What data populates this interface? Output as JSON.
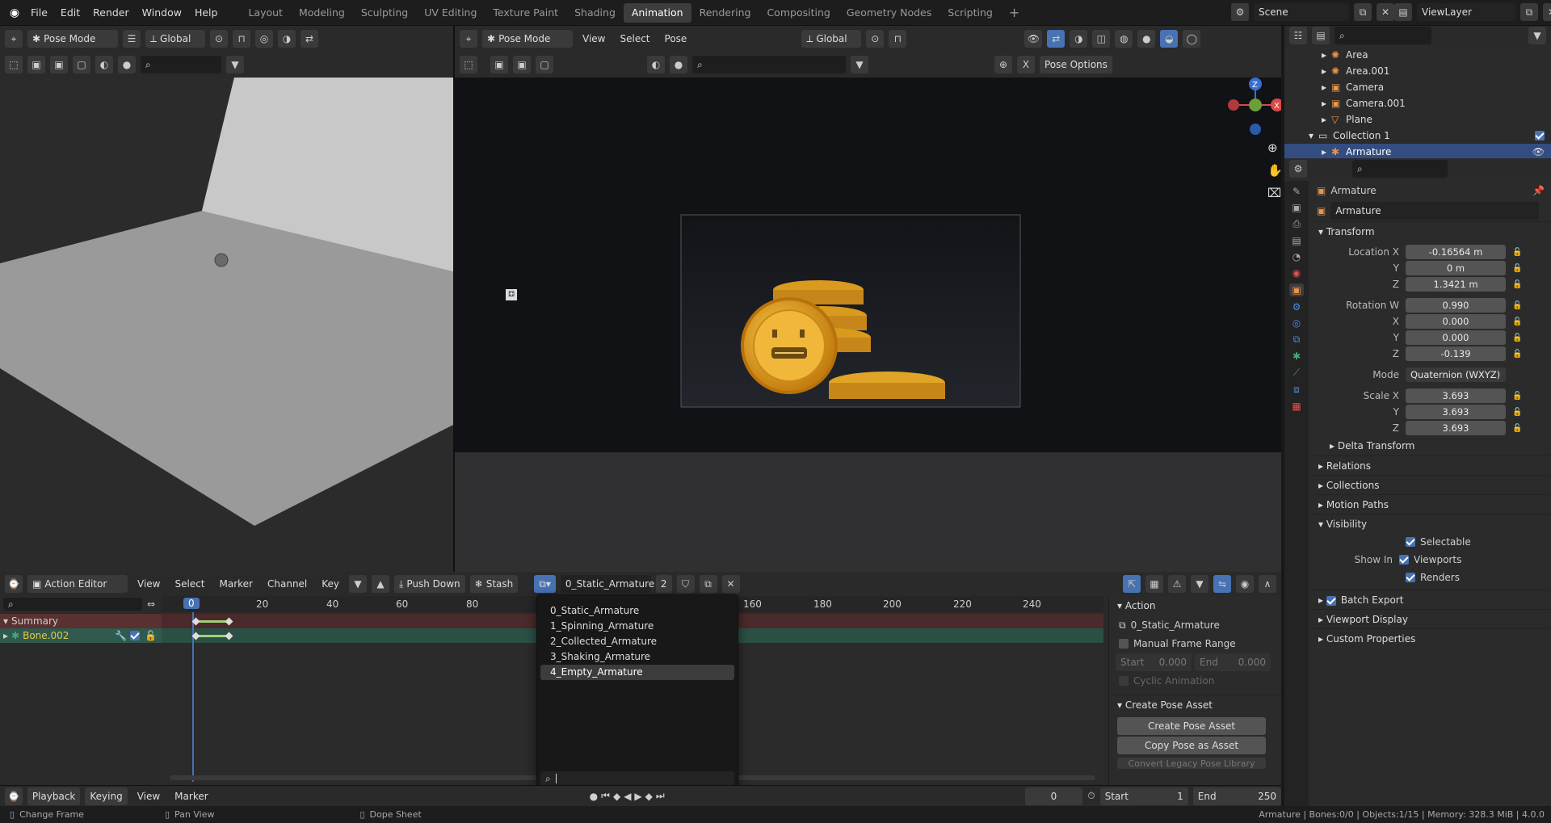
{
  "topbar": {
    "menus": [
      "File",
      "Edit",
      "Render",
      "Window",
      "Help"
    ],
    "workspaces": [
      "Layout",
      "Modeling",
      "Sculpting",
      "UV Editing",
      "Texture Paint",
      "Shading",
      "Animation",
      "Rendering",
      "Compositing",
      "Geometry Nodes",
      "Scripting"
    ],
    "active_workspace": "Animation",
    "scene": "Scene",
    "view_layer": "ViewLayer"
  },
  "left_viewport": {
    "mode": "Pose Mode",
    "orientation": "Global"
  },
  "right_viewport": {
    "mode": "Pose Mode",
    "menus": [
      "View",
      "Select",
      "Pose"
    ],
    "orientation": "Global",
    "pose_options": "Pose Options"
  },
  "outliner": {
    "items": [
      {
        "name": "Area",
        "indent": 1
      },
      {
        "name": "Area.001",
        "indent": 1
      },
      {
        "name": "Camera",
        "indent": 1
      },
      {
        "name": "Camera.001",
        "indent": 1
      },
      {
        "name": "Plane",
        "indent": 1
      },
      {
        "name": "Collection 1",
        "indent": 0
      },
      {
        "name": "Armature",
        "indent": 1,
        "selected": true
      }
    ]
  },
  "properties": {
    "object_name": "Armature",
    "data_name": "Armature",
    "transform_label": "Transform",
    "location": {
      "label": "Location X",
      "x": "-0.16564 m",
      "y": "0 m",
      "z": "1.3421 m"
    },
    "rotation": {
      "label": "Rotation W",
      "w": "0.990",
      "x": "0.000",
      "y": "0.000",
      "z": "-0.139"
    },
    "mode_label": "Mode",
    "mode_value": "Quaternion (WXYZ)",
    "scale": {
      "label": "Scale X",
      "x": "3.693",
      "y": "3.693",
      "z": "3.693"
    },
    "axis": {
      "y": "Y",
      "z": "Z",
      "x": "X"
    },
    "sections": [
      "Delta Transform",
      "Relations",
      "Collections",
      "Motion Paths"
    ],
    "visibility_label": "Visibility",
    "selectable": "Selectable",
    "show_in": "Show In",
    "viewports": "Viewports",
    "renders": "Renders",
    "batch_export": "Batch Export",
    "viewport_display": "Viewport Display",
    "custom_properties": "Custom Properties"
  },
  "dopesheet": {
    "editor": "Action Editor",
    "menus": [
      "View",
      "Select",
      "Marker",
      "Channel",
      "Key"
    ],
    "push_down": "Push Down",
    "stash": "Stash",
    "action": "0_Static_Armature",
    "users": "2",
    "frames": [
      "0",
      "20",
      "40",
      "60",
      "80",
      "160",
      "180",
      "200",
      "220",
      "240"
    ],
    "channels": {
      "summary": "Summary",
      "bone": "Bone.002"
    },
    "action_panel": {
      "title": "Action",
      "action_name": "0_Static_Armature",
      "manual_range": "Manual Frame Range",
      "start_label": "Start",
      "start": "0.000",
      "end_label": "End",
      "end": "0.000",
      "cyclic": "Cyclic Animation",
      "pose_asset_title": "Create Pose Asset",
      "create_pose_asset": "Create Pose Asset",
      "copy_pose": "Copy Pose as Asset",
      "convert_legacy": "Convert Legacy Pose Library"
    }
  },
  "dropdown": {
    "items": [
      "0_Static_Armature",
      "1_Spinning_Armature",
      "2_Collected_Armature",
      "3_Shaking_Armature",
      "4_Empty_Armature"
    ],
    "selected": 4
  },
  "timeline": {
    "menus": [
      "Playback",
      "Keying",
      "View",
      "Marker"
    ],
    "current": "0",
    "start_label": "Start",
    "start": "1",
    "end_label": "End",
    "end": "250"
  },
  "statusbar": {
    "left": [
      "Change Frame",
      "Pan View",
      "Dope Sheet"
    ],
    "right": "Armature | Bones:0/0 | Objects:1/15 | Memory: 328.3 MiB | 4.0.0"
  }
}
